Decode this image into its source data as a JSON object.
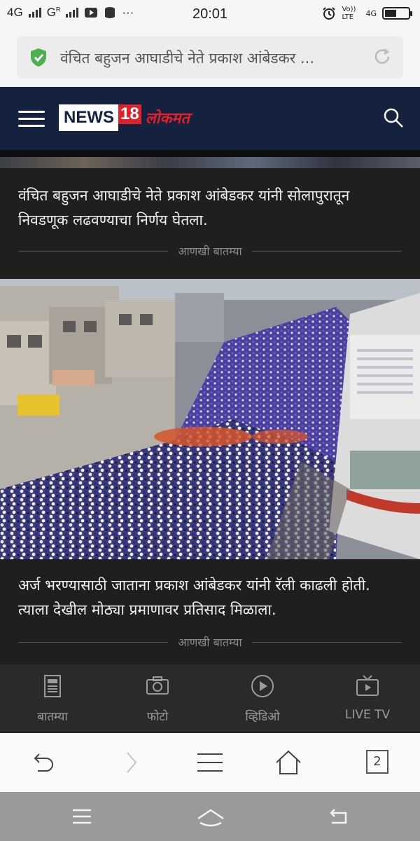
{
  "status": {
    "left": [
      "4G",
      "G",
      "R",
      "···"
    ],
    "time": "20:01",
    "right": [
      "Vo)) LTE",
      "4G"
    ]
  },
  "browser": {
    "url_title": "वंचित बहुजन आघाडीचे नेते प्रकाश आंबेडकर ...",
    "tab_count": "2"
  },
  "site": {
    "logo_news": "NEWS",
    "logo_18": "18",
    "logo_lokmat": "लोकमत"
  },
  "articles": [
    {
      "text": "वंचित बहुजन आघाडीचे नेते प्रकाश आंबेडकर यांनी सोलापुरातून निवडणूक लढवण्याचा निर्णय घेतला.",
      "more": "आणखी बातम्या"
    },
    {
      "text": "अर्ज भरण्यासाठी जाताना प्रकाश आंबेडकर यांनी रॅली काढली होती. त्याला देखील मोठ्या प्रमाणावर प्रतिसाद मिळाला.",
      "more": "आणखी बातम्या"
    }
  ],
  "bottom_nav": [
    {
      "label": "बातम्या",
      "icon": "news-icon"
    },
    {
      "label": "फोटो",
      "icon": "camera-icon"
    },
    {
      "label": "व्हिडिओ",
      "icon": "play-icon"
    },
    {
      "label": "LIVE TV",
      "icon": "tv-icon"
    }
  ],
  "colors": {
    "header_bg": "#14213f",
    "brand_red": "#e0212b",
    "card_bg": "#1f1f1f",
    "shield_green": "#4caf50"
  }
}
